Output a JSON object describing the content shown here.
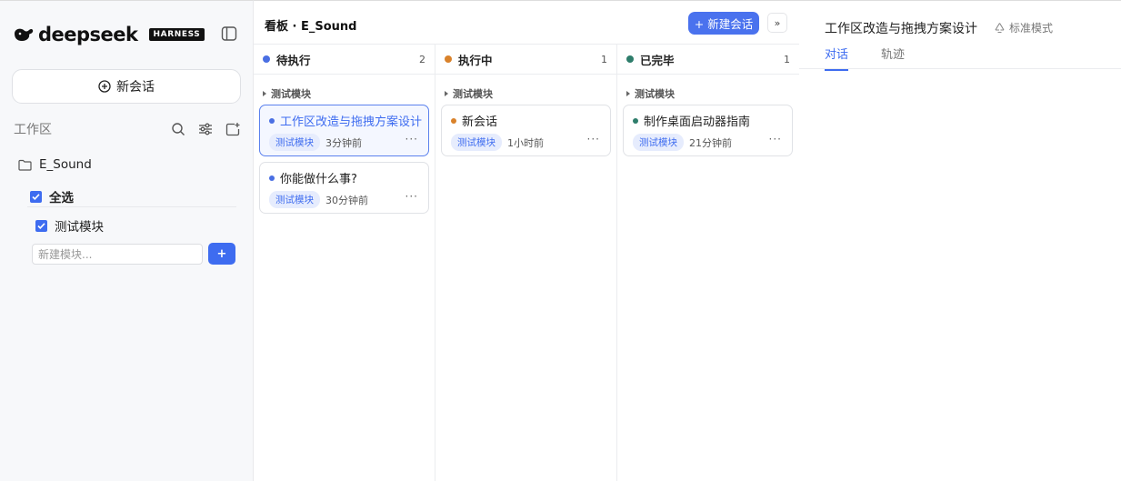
{
  "sidebar": {
    "logo_text": "deepseek",
    "logo_badge": "HARNESS",
    "new_chat_label": "新会话",
    "workspace_title": "工作区",
    "workspace_name": "E_Sound",
    "select_all_label": "全选",
    "module_label": "测试模块",
    "new_module_placeholder": "新建模块...",
    "add_module_label": "+"
  },
  "board": {
    "title": "看板 · E_Sound",
    "new_session_label": "+ 新建会话",
    "expand_label": "»",
    "columns": [
      {
        "name": "待执行",
        "count": "2",
        "color": "#4a6fe3",
        "group": "测试模块",
        "cards": [
          {
            "title": "工作区改造与拖拽方案设计",
            "tag": "测试模块",
            "time": "3分钟前",
            "dot": "#4a6fe3"
          },
          {
            "title": "你能做什么事?",
            "tag": "测试模块",
            "time": "30分钟前",
            "dot": "#4a6fe3"
          }
        ]
      },
      {
        "name": "执行中",
        "count": "1",
        "color": "#d9822b",
        "group": "测试模块",
        "cards": [
          {
            "title": "新会话",
            "tag": "测试模块",
            "time": "1小时前",
            "dot": "#d9822b"
          }
        ]
      },
      {
        "name": "已完毕",
        "count": "1",
        "color": "#2e7d6b",
        "group": "测试模块",
        "cards": [
          {
            "title": "制作桌面启动器指南",
            "tag": "测试模块",
            "time": "21分钟前",
            "dot": "#2e7d6b"
          }
        ]
      }
    ]
  },
  "detail": {
    "title": "工作区改造与拖拽方案设计",
    "mode_label": "标准模式",
    "tabs": [
      "对话",
      "轨迹"
    ]
  },
  "colors": {
    "accent": "#3e6cf0"
  }
}
